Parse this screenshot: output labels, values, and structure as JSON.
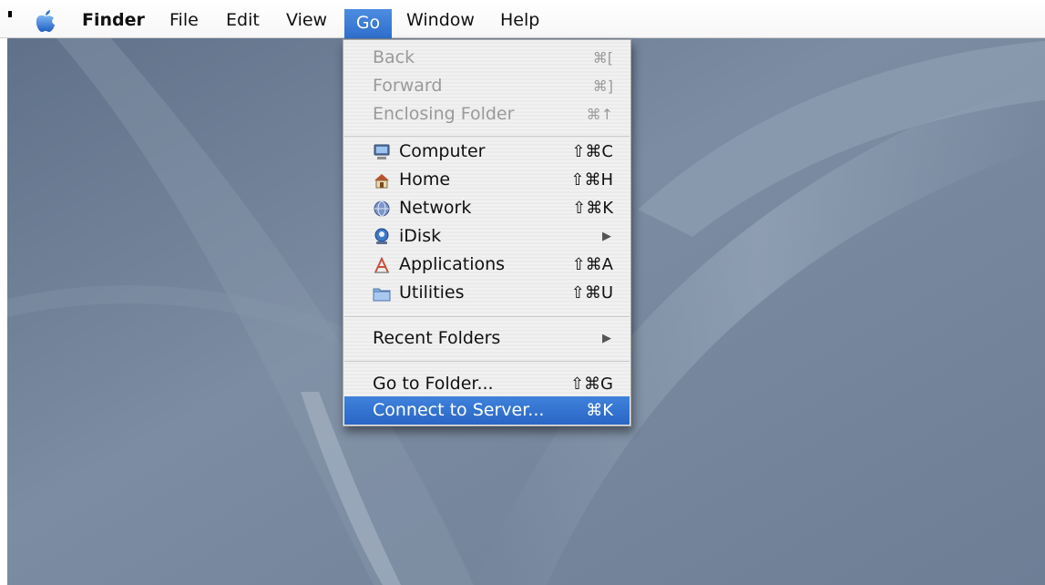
{
  "menubar": {
    "apple_icon": "apple-icon",
    "items": [
      {
        "label": "Finder"
      },
      {
        "label": "File"
      },
      {
        "label": "Edit"
      },
      {
        "label": "View"
      },
      {
        "label": "Go"
      },
      {
        "label": "Window"
      },
      {
        "label": "Help"
      }
    ]
  },
  "go_menu": {
    "items": [
      {
        "label": "Back",
        "shortcut": "⌘[",
        "enabled": false
      },
      {
        "label": "Forward",
        "shortcut": "⌘]",
        "enabled": false
      },
      {
        "label": "Enclosing Folder",
        "shortcut": "⌘↑",
        "enabled": false
      },
      {
        "label": "Computer",
        "shortcut": "⇧⌘C",
        "icon": "computer-icon"
      },
      {
        "label": "Home",
        "shortcut": "⇧⌘H",
        "icon": "home-icon"
      },
      {
        "label": "Network",
        "shortcut": "⇧⌘K",
        "icon": "network-icon"
      },
      {
        "label": "iDisk",
        "submenu_arrow": "▶",
        "icon": "idisk-icon"
      },
      {
        "label": "Applications",
        "shortcut": "⇧⌘A",
        "icon": "applications-icon"
      },
      {
        "label": "Utilities",
        "shortcut": "⇧⌘U",
        "icon": "utilities-folder-icon"
      },
      {
        "label": "Recent Folders",
        "submenu_arrow": "▶"
      },
      {
        "label": "Go to Folder...",
        "shortcut": "⇧⌘G"
      },
      {
        "label": "Connect to Server...",
        "shortcut": "⌘K",
        "selected": true
      }
    ]
  },
  "colors": {
    "selection": "#2f6fcd",
    "wallpaper": "#6f8097"
  }
}
